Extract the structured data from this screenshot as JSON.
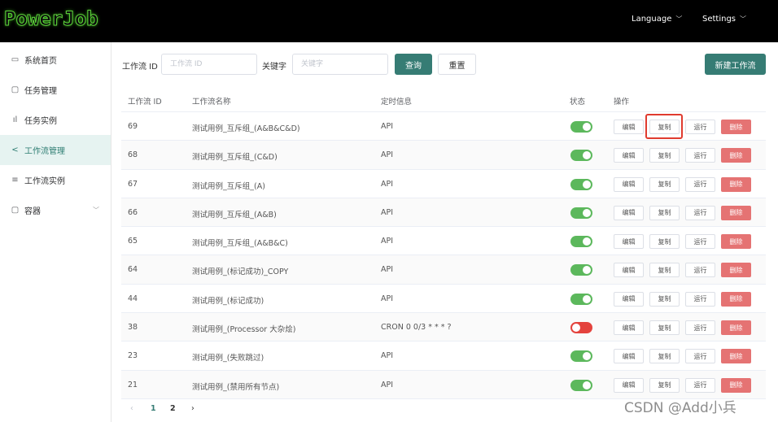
{
  "header": {
    "logo": "PowerJob",
    "language_label": "Language",
    "settings_label": "Settings"
  },
  "sidebar": {
    "items": [
      {
        "label": "系统首页",
        "icon": "monitor-icon"
      },
      {
        "label": "任务管理",
        "icon": "task-icon"
      },
      {
        "label": "任务实例",
        "icon": "bar-chart-icon"
      },
      {
        "label": "工作流管理",
        "icon": "share-icon",
        "active": true
      },
      {
        "label": "工作流实例",
        "icon": "sliders-icon"
      },
      {
        "label": "容器",
        "icon": "container-icon",
        "expandable": true
      }
    ]
  },
  "filters": {
    "workflow_id_label": "工作流 ID",
    "workflow_id_placeholder": "工作流 ID",
    "workflow_id_value": "",
    "keyword_label": "关键字",
    "keyword_placeholder": "关键字",
    "keyword_value": "",
    "query_label": "查询",
    "reset_label": "重置",
    "new_workflow_label": "新建工作流"
  },
  "table": {
    "headers": {
      "id": "工作流 ID",
      "name": "工作流名称",
      "schedule": "定时信息",
      "status": "状态",
      "actions": "操作"
    },
    "action_labels": {
      "edit": "编辑",
      "copy": "复制",
      "run": "运行",
      "delete": "删除"
    },
    "rows": [
      {
        "id": "69",
        "name": "测试用例_互斥组_(A&B&C&D)",
        "schedule": "API",
        "enabled": true
      },
      {
        "id": "68",
        "name": "测试用例_互斥组_(C&D)",
        "schedule": "API",
        "enabled": true
      },
      {
        "id": "67",
        "name": "测试用例_互斥组_(A)",
        "schedule": "API",
        "enabled": true
      },
      {
        "id": "66",
        "name": "测试用例_互斥组_(A&B)",
        "schedule": "API",
        "enabled": true
      },
      {
        "id": "65",
        "name": "测试用例_互斥组_(A&B&C)",
        "schedule": "API",
        "enabled": true
      },
      {
        "id": "64",
        "name": "测试用例_(标记成功)_COPY",
        "schedule": "API",
        "enabled": true
      },
      {
        "id": "44",
        "name": "测试用例_(标记成功)",
        "schedule": "API",
        "enabled": true
      },
      {
        "id": "38",
        "name": "测试用例_(Processor 大杂烩)",
        "schedule": "CRON 0 0/3 * * * ?",
        "enabled": false
      },
      {
        "id": "23",
        "name": "测试用例_(失败跳过)",
        "schedule": "API",
        "enabled": true
      },
      {
        "id": "21",
        "name": "测试用例_(禁用所有节点)",
        "schedule": "API",
        "enabled": true
      }
    ]
  },
  "pagination": {
    "prev": "‹",
    "pages": [
      "1",
      "2"
    ],
    "current": "1",
    "next": "›"
  },
  "watermark": "CSDN @Add小兵",
  "colors": {
    "primary": "#367c74",
    "switch_on": "#5cb85c",
    "switch_off": "#e4433d",
    "danger": "#e57373",
    "highlight": "#e03b2f"
  }
}
